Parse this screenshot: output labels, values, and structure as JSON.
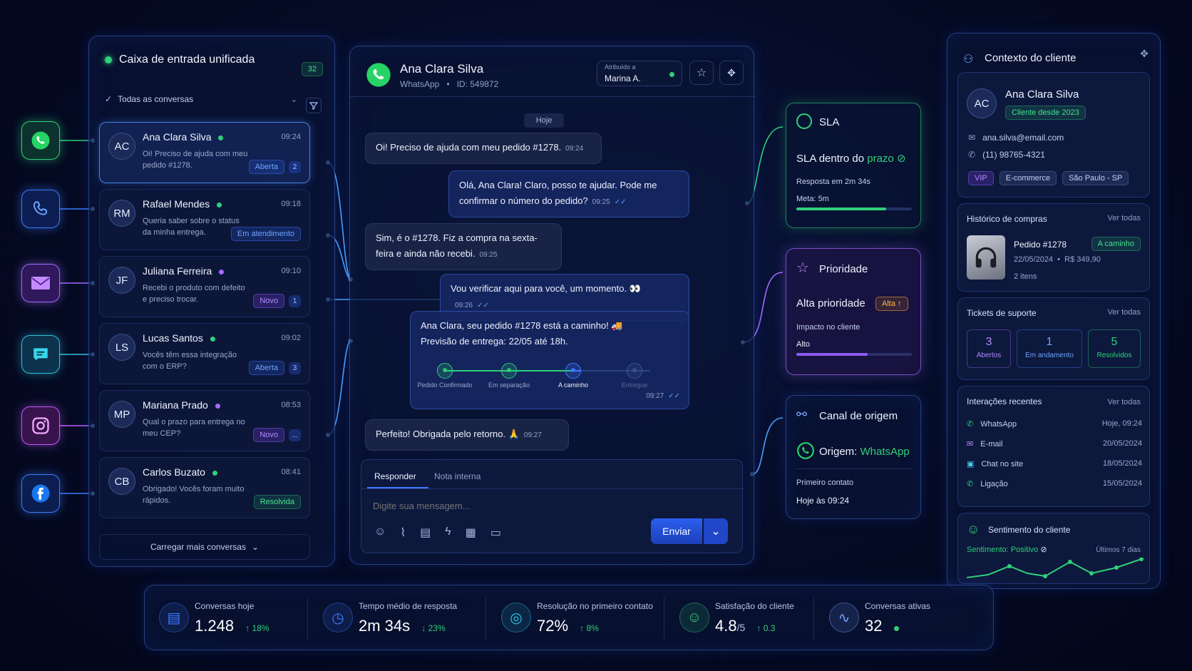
{
  "inbox": {
    "title": "Caixa de entrada unificada",
    "count": "32",
    "filter": "Todas as conversas",
    "load_more": "Carregar mais conversas",
    "conversations": [
      {
        "initials": "AC",
        "name": "Ana Clara Silva",
        "time": "09:24",
        "preview": "Oi! Preciso de ajuda com meu pedido #1278.",
        "status": "Aberta",
        "unread": "2"
      },
      {
        "initials": "RM",
        "name": "Rafael Mendes",
        "time": "09:18",
        "preview": "Queria saber sobre o status da minha entrega.",
        "status": "Em atendimento",
        "unread": ""
      },
      {
        "initials": "JF",
        "name": "Juliana Ferreira",
        "time": "09:10",
        "preview": "Recebi o produto com defeito e preciso trocar.",
        "status": "Novo",
        "unread": "1"
      },
      {
        "initials": "LS",
        "name": "Lucas Santos",
        "time": "09:02",
        "preview": "Vocês têm essa integração com o ERP?",
        "status": "Aberta",
        "unread": "3"
      },
      {
        "initials": "MP",
        "name": "Mariana Prado",
        "time": "08:53",
        "preview": "Qual o prazo para entrega no meu CEP?",
        "status": "Novo",
        "unread": "..."
      },
      {
        "initials": "CB",
        "name": "Carlos Buzato",
        "time": "08:41",
        "preview": "Obrigado! Vocês foram muito rápidos.",
        "status": "Resolvida",
        "unread": ""
      }
    ]
  },
  "chat": {
    "name": "Ana Clara Silva",
    "channel": "WhatsApp",
    "id": "ID: 549872",
    "assigned_label": "Atribuído a",
    "assigned_to": "Marina A.",
    "day": "Hoje",
    "messages": [
      {
        "dir": "in",
        "text": "Oi! Preciso de ajuda com meu pedido #1278.",
        "time": "09:24"
      },
      {
        "dir": "out",
        "text": "Olá, Ana Clara! Claro, posso te ajudar. Pode me confirmar o número do pedido?",
        "time": "09:25"
      },
      {
        "dir": "in",
        "text": "Sim, é o #1278. Fiz a compra na sexta-feira e ainda não recebi.",
        "time": "09:25"
      },
      {
        "dir": "out",
        "text": "Vou verificar aqui para você, um momento. 👀",
        "time": "09:26"
      },
      {
        "dir": "out",
        "text": "Ana Clara, seu pedido #1278 está a caminho! 🚚 Previsão de entrega: 22/05 até 18h.",
        "time": "09:27"
      },
      {
        "dir": "in",
        "text": "Perfeito! Obrigada pelo retorno. 🙏",
        "time": "09:27"
      }
    ],
    "tracking": [
      "Pedido Confirmado",
      "Em separação",
      "A caminho",
      "Entregue"
    ],
    "tab_reply": "Responder",
    "tab_note": "Nota interna",
    "placeholder": "Digite sua mensagem...",
    "send": "Enviar"
  },
  "sla": {
    "title": "SLA",
    "headline_a": "SLA dentro do ",
    "headline_b": "prazo",
    "response": "Resposta em 2m 34s",
    "meta": "Meta: 5m",
    "progress": 0.78
  },
  "priority": {
    "title": "Prioridade",
    "headline": "Alta prioridade",
    "badge": "Alta",
    "impact_label": "Impacto no cliente",
    "impact": "Alto",
    "progress": 0.62
  },
  "origin": {
    "title": "Canal de origem",
    "label": "Origem: ",
    "channel": "WhatsApp",
    "first_label": "Primeiro contato",
    "first": "Hoje às 09:24"
  },
  "customer": {
    "title": "Contexto do cliente",
    "initials": "AC",
    "name": "Ana Clara Silva",
    "since": "Cliente desde 2023",
    "email": "ana.silva@email.com",
    "phone": "(11) 98765-4321",
    "tags": [
      "VIP",
      "E-commerce",
      "São Paulo - SP"
    ],
    "purchases_title": "Histórico de compras",
    "see_all": "Ver todas",
    "order": "Pedido #1278",
    "order_status": "A caminho",
    "order_date": "22/05/2024",
    "order_value": "R$ 349,90",
    "order_items": "2 itens",
    "tickets_title": "Tickets de suporte",
    "tickets": [
      {
        "n": "3",
        "l": "Abertos"
      },
      {
        "n": "1",
        "l": "Em andamento"
      },
      {
        "n": "5",
        "l": "Resolvidos"
      }
    ],
    "interactions_title": "Interações recentes",
    "interactions": [
      {
        "ch": "WhatsApp",
        "d": "Hoje, 09:24"
      },
      {
        "ch": "E-mail",
        "d": "20/05/2024"
      },
      {
        "ch": "Chat no site",
        "d": "18/05/2024"
      },
      {
        "ch": "Ligação",
        "d": "15/05/2024"
      }
    ],
    "sentiment_title": "Sentimento do cliente",
    "sentiment_label": "Sentimento: ",
    "sentiment": "Positivo",
    "sentiment_period": "Últimos 7 dias"
  },
  "stats": [
    {
      "label": "Conversas hoje",
      "value": "1.248",
      "delta": "↑ 18%"
    },
    {
      "label": "Tempo médio de resposta",
      "value": "2m 34s",
      "delta": "↓ 23%"
    },
    {
      "label": "Resolução no primeiro contato",
      "value": "72%",
      "delta": "↑ 8%"
    },
    {
      "label": "Satisfação do cliente",
      "value": "4.8",
      "suffix": "/5",
      "delta": "↑ 0.3"
    },
    {
      "label": "Conversas ativas",
      "value": "32",
      "delta": ""
    }
  ],
  "colors": {
    "accent": "#3d7bff",
    "green": "#2fd07a",
    "purple": "#8b5cf6",
    "whatsapp": "#25d366"
  }
}
